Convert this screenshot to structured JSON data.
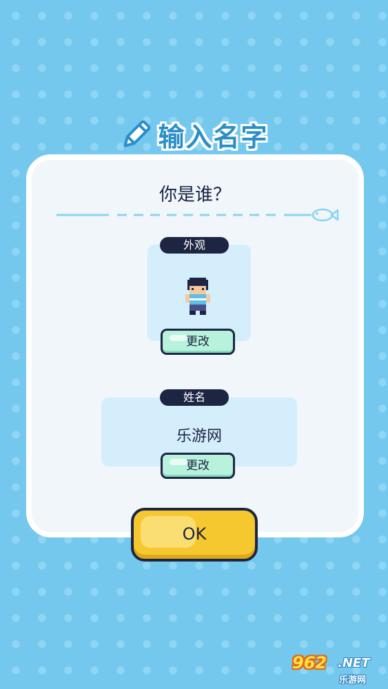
{
  "header": {
    "title": "输入名字",
    "icon": "pencil-icon"
  },
  "dialog": {
    "question": "你是谁？",
    "appearance": {
      "label": "外观",
      "change_label": "更改"
    },
    "name_section": {
      "label": "姓名",
      "value": "乐游网",
      "change_label": "更改"
    },
    "divider_icon": "fish-icon"
  },
  "confirm": {
    "label": "OK"
  },
  "watermark": {
    "number": "962",
    "net": ".NET",
    "site": "乐游网"
  },
  "colors": {
    "background": "#74c8ee",
    "title": "#2a8fc9",
    "panel": "#f0f6fa",
    "section": "#d4eefc",
    "tag": "#1c2542",
    "change_button": "#b8f2dc",
    "ok_button": "#f6c830"
  }
}
